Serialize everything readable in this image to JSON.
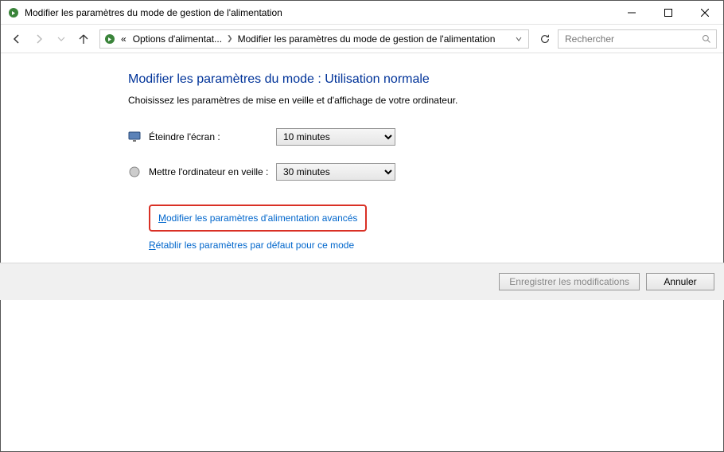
{
  "window": {
    "title": "Modifier les paramètres du mode de gestion de l'alimentation"
  },
  "breadcrumb": {
    "prefix": "«",
    "items": [
      "Options d'alimentat...",
      "Modifier les paramètres du mode de gestion de l'alimentation"
    ]
  },
  "search": {
    "placeholder": "Rechercher"
  },
  "page": {
    "title": "Modifier les paramètres du mode : Utilisation normale",
    "subtitle": "Choisissez les paramètres de mise en veille et d'affichage de votre ordinateur."
  },
  "settings": {
    "display_off": {
      "label": "Éteindre l'écran :",
      "value": "10 minutes"
    },
    "sleep": {
      "label": "Mettre l'ordinateur en veille :",
      "value": "30 minutes"
    }
  },
  "links": {
    "advanced": "Modifier les paramètres d'alimentation avancés",
    "restore": "Rétablir les paramètres par défaut pour ce mode"
  },
  "buttons": {
    "save": "Enregistrer les modifications",
    "cancel": "Annuler"
  }
}
